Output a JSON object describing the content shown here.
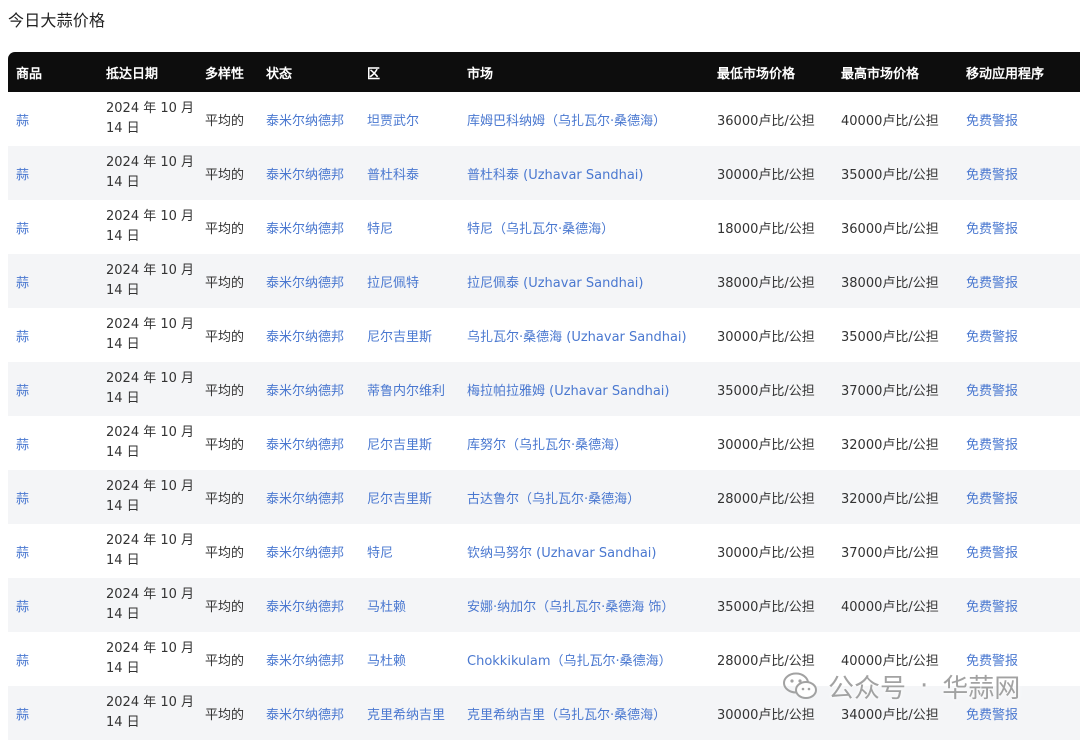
{
  "page": {
    "title": "今日大蒜价格"
  },
  "table": {
    "headers": [
      "商品",
      "抵达日期",
      "多样性",
      "状态",
      "区",
      "市场",
      "最低市场价格",
      "最高市场价格",
      "移动应用程序"
    ],
    "rows": [
      {
        "commodity": "蒜",
        "date_line1": "2024 年 10 月",
        "date_line2": "14 日",
        "variety": "平均的",
        "state": "泰米尔纳德邦",
        "district": "坦贾武尔",
        "market": "库姆巴科纳姆（乌扎瓦尔·桑德海）",
        "min_price": "36000卢比/公担",
        "max_price": "40000卢比/公担",
        "app": "免费警报"
      },
      {
        "commodity": "蒜",
        "date_line1": "2024 年 10 月",
        "date_line2": "14 日",
        "variety": "平均的",
        "state": "泰米尔纳德邦",
        "district": "普杜科泰",
        "market": "普杜科泰 (Uzhavar Sandhai)",
        "min_price": "30000卢比/公担",
        "max_price": "35000卢比/公担",
        "app": "免费警报"
      },
      {
        "commodity": "蒜",
        "date_line1": "2024 年 10 月",
        "date_line2": "14 日",
        "variety": "平均的",
        "state": "泰米尔纳德邦",
        "district": "特尼",
        "market": "特尼（乌扎瓦尔·桑德海）",
        "min_price": "18000卢比/公担",
        "max_price": "36000卢比/公担",
        "app": "免费警报"
      },
      {
        "commodity": "蒜",
        "date_line1": "2024 年 10 月",
        "date_line2": "14 日",
        "variety": "平均的",
        "state": "泰米尔纳德邦",
        "district": "拉尼佩特",
        "market": "拉尼佩泰 (Uzhavar Sandhai)",
        "min_price": "38000卢比/公担",
        "max_price": "38000卢比/公担",
        "app": "免费警报"
      },
      {
        "commodity": "蒜",
        "date_line1": "2024 年 10 月",
        "date_line2": "14 日",
        "variety": "平均的",
        "state": "泰米尔纳德邦",
        "district": "尼尔吉里斯",
        "market": "乌扎瓦尔·桑德海 (Uzhavar Sandhai)",
        "min_price": "30000卢比/公担",
        "max_price": "35000卢比/公担",
        "app": "免费警报"
      },
      {
        "commodity": "蒜",
        "date_line1": "2024 年 10 月",
        "date_line2": "14 日",
        "variety": "平均的",
        "state": "泰米尔纳德邦",
        "district": "蒂鲁内尔维利",
        "market": "梅拉帕拉雅姆 (Uzhavar Sandhai)",
        "min_price": "35000卢比/公担",
        "max_price": "37000卢比/公担",
        "app": "免费警报"
      },
      {
        "commodity": "蒜",
        "date_line1": "2024 年 10 月",
        "date_line2": "14 日",
        "variety": "平均的",
        "state": "泰米尔纳德邦",
        "district": "尼尔吉里斯",
        "market": "库努尔（乌扎瓦尔·桑德海）",
        "min_price": "30000卢比/公担",
        "max_price": "32000卢比/公担",
        "app": "免费警报"
      },
      {
        "commodity": "蒜",
        "date_line1": "2024 年 10 月",
        "date_line2": "14 日",
        "variety": "平均的",
        "state": "泰米尔纳德邦",
        "district": "尼尔吉里斯",
        "market": "古达鲁尔（乌扎瓦尔·桑德海）",
        "min_price": "28000卢比/公担",
        "max_price": "32000卢比/公担",
        "app": "免费警报"
      },
      {
        "commodity": "蒜",
        "date_line1": "2024 年 10 月",
        "date_line2": "14 日",
        "variety": "平均的",
        "state": "泰米尔纳德邦",
        "district": "特尼",
        "market": "钦纳马努尔 (Uzhavar Sandhai)",
        "min_price": "30000卢比/公担",
        "max_price": "37000卢比/公担",
        "app": "免费警报"
      },
      {
        "commodity": "蒜",
        "date_line1": "2024 年 10 月",
        "date_line2": "14 日",
        "variety": "平均的",
        "state": "泰米尔纳德邦",
        "district": "马杜赖",
        "market": "安娜·纳加尔（乌扎瓦尔·桑德海 饰）",
        "min_price": "35000卢比/公担",
        "max_price": "40000卢比/公担",
        "app": "免费警报"
      },
      {
        "commodity": "蒜",
        "date_line1": "2024 年 10 月",
        "date_line2": "14 日",
        "variety": "平均的",
        "state": "泰米尔纳德邦",
        "district": "马杜赖",
        "market": "Chokkikulam（乌扎瓦尔·桑德海）",
        "min_price": "28000卢比/公担",
        "max_price": "40000卢比/公担",
        "app": "免费警报"
      },
      {
        "commodity": "蒜",
        "date_line1": "2024 年 10 月",
        "date_line2": "14 日",
        "variety": "平均的",
        "state": "泰米尔纳德邦",
        "district": "克里希纳吉里",
        "market": "克里希纳吉里（乌扎瓦尔·桑德海）",
        "min_price": "30000卢比/公担",
        "max_price": "34000卢比/公担",
        "app": "免费警报"
      }
    ]
  },
  "watermark": {
    "text_left": "公众号",
    "separator": "·",
    "text_right": "华蒜网",
    "icon": "wechat-icon"
  }
}
